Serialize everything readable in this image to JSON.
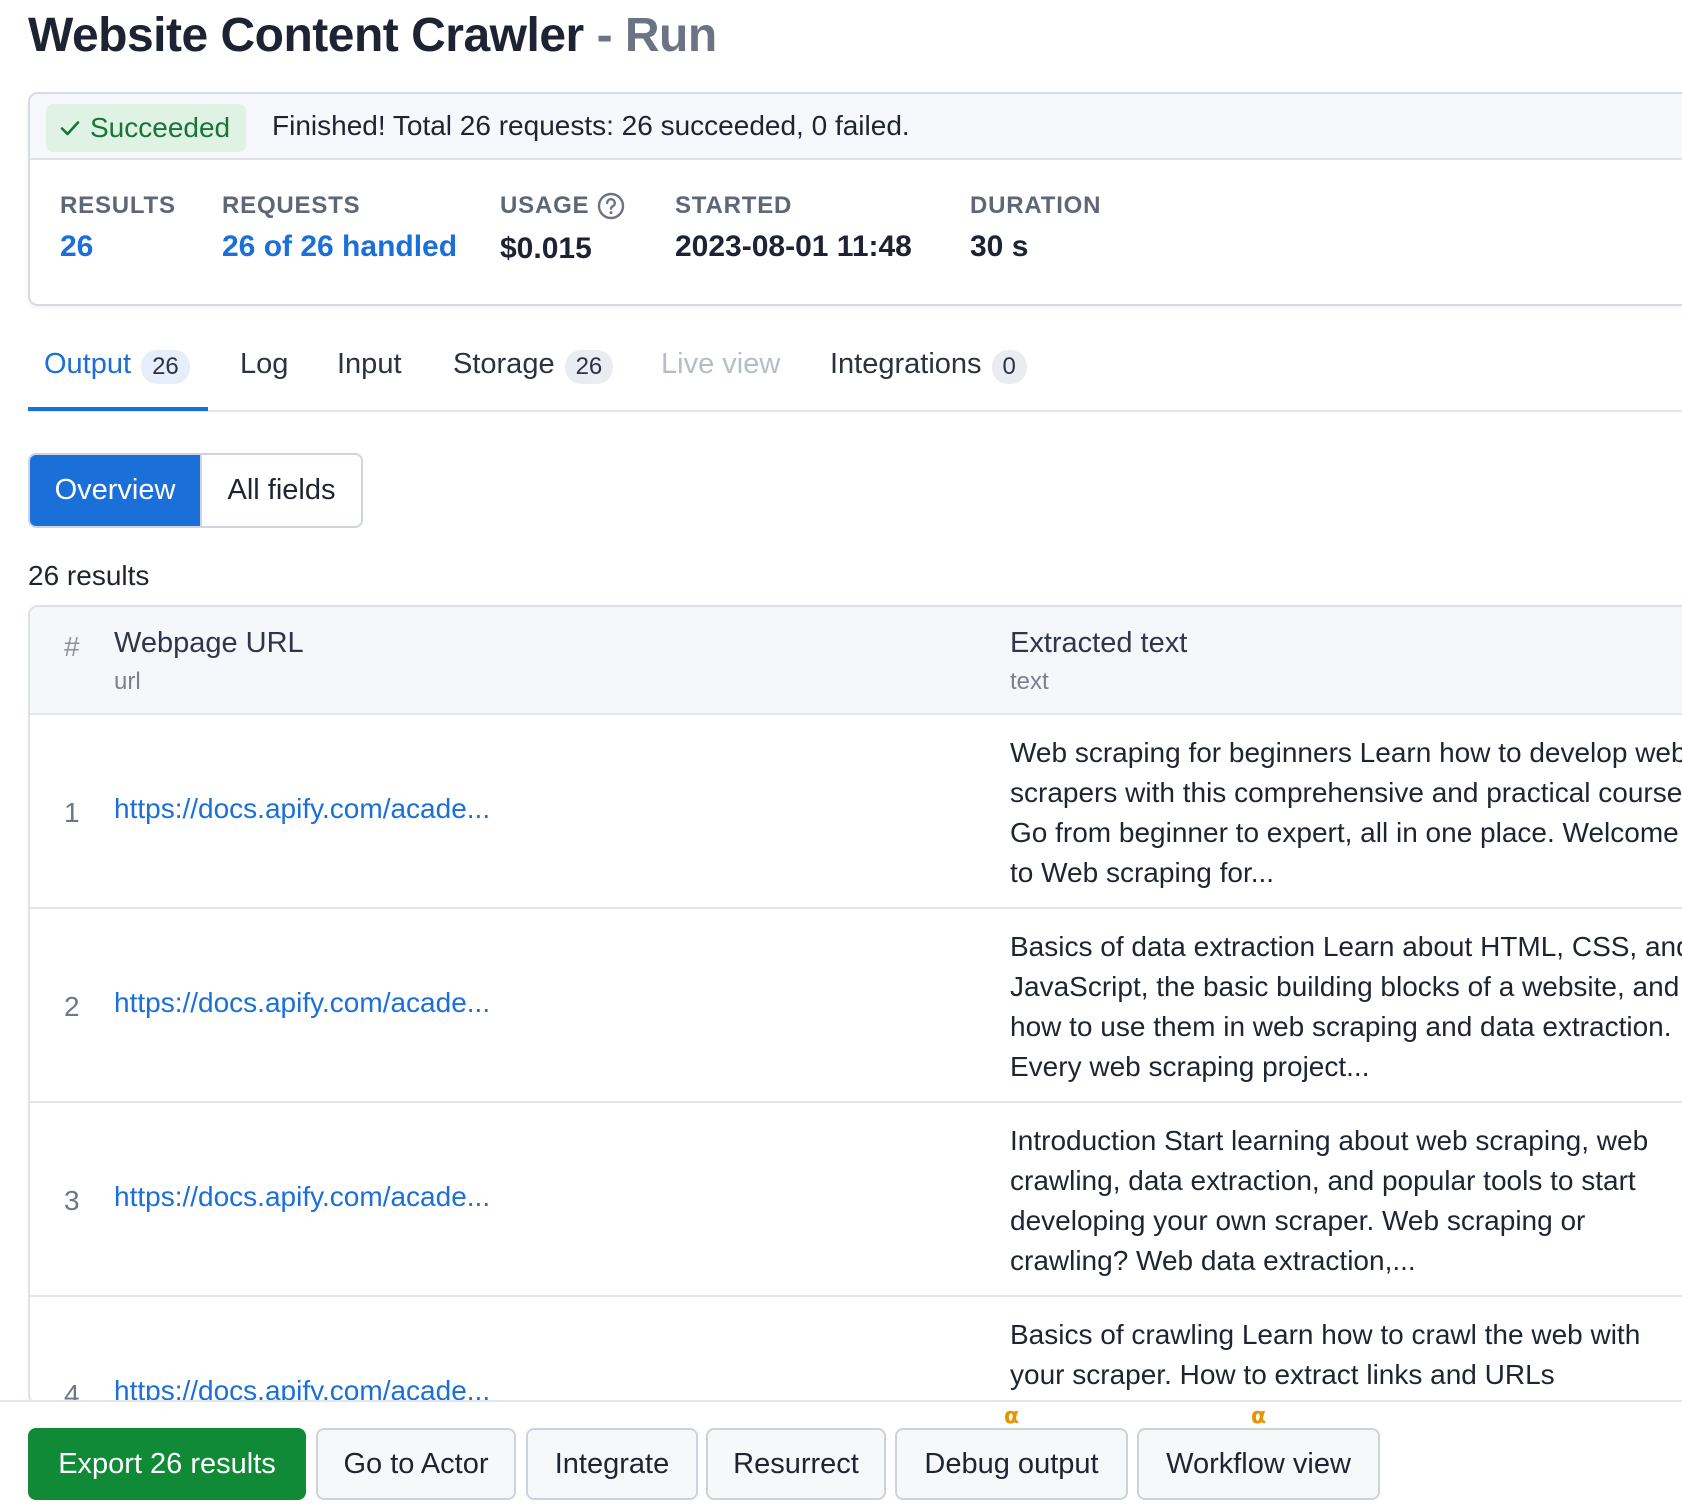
{
  "title": {
    "name": "Website Content Crawler",
    "separator": "-",
    "suffix": "Run"
  },
  "status": {
    "badge": "Succeeded",
    "message": "Finished! Total 26 requests: 26 succeeded, 0 failed."
  },
  "stats": {
    "results": {
      "label": "RESULTS",
      "value": "26"
    },
    "requests": {
      "label": "REQUESTS",
      "value": "26 of 26 handled"
    },
    "usage": {
      "label": "USAGE",
      "value": "$0.015"
    },
    "started": {
      "label": "STARTED",
      "value": "2023-08-01 11:48"
    },
    "duration": {
      "label": "DURATION",
      "value": "30 s"
    }
  },
  "tabs": [
    {
      "label": "Output",
      "count": "26",
      "state": "active"
    },
    {
      "label": "Log"
    },
    {
      "label": "Input"
    },
    {
      "label": "Storage",
      "count": "26"
    },
    {
      "label": "Live view",
      "state": "disabled"
    },
    {
      "label": "Integrations",
      "count": "0"
    }
  ],
  "view_toggle": {
    "overview": "Overview",
    "all_fields": "All fields",
    "selected": "Overview"
  },
  "results_count": "26 results",
  "table": {
    "hash": "#",
    "columns": [
      {
        "title": "Webpage URL",
        "key": "url"
      },
      {
        "title": "Extracted text",
        "key": "text"
      }
    ],
    "rows": [
      {
        "num": "1",
        "url": "https://docs.apify.com/acade...",
        "text": "Web scraping for beginners Learn how to develop web scrapers with this comprehensive and practical course. Go from beginner to expert, all in one place. Welcome to Web scraping for..."
      },
      {
        "num": "2",
        "url": "https://docs.apify.com/acade...",
        "text": "Basics of data extraction Learn about HTML, CSS, and JavaScript, the basic building blocks of a website, and how to use them in web scraping and data extraction. Every web scraping project..."
      },
      {
        "num": "3",
        "url": "https://docs.apify.com/acade...",
        "text": "Introduction Start learning about web scraping, web crawling, data extraction, and popular tools to start developing your own scraper. Web scraping or crawling? Web data extraction,..."
      },
      {
        "num": "4",
        "url": "https://docs.apify.com/acade...",
        "text": "Basics of crawling Learn how to crawl the web with your scraper. How to extract links and URLs"
      }
    ]
  },
  "actions": {
    "export": "Export 26 results",
    "go_to_actor": "Go to Actor",
    "integrate": "Integrate",
    "resurrect": "Resurrect",
    "debug_output": "Debug output",
    "workflow_view": "Workflow view",
    "alpha_marker": "α"
  },
  "colors": {
    "accent": "#1a6fd9",
    "success": "#108a37",
    "success_bg": "#dff2e4",
    "alpha": "#e69500"
  }
}
